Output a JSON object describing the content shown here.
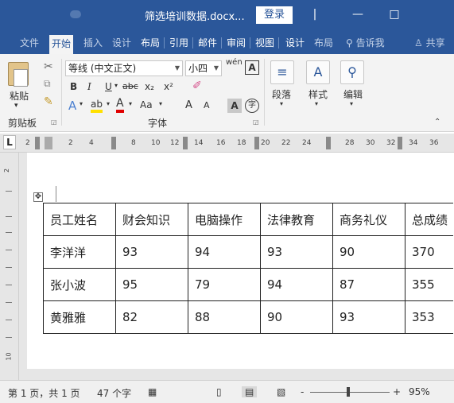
{
  "window": {
    "title": "筛选培训数据.docx...",
    "login_label": "登录",
    "controls": [
      "|",
      "—",
      "□"
    ]
  },
  "ribbon_tabs": [
    {
      "label": "文件",
      "style": "dim"
    },
    {
      "label": "开始",
      "style": "active"
    },
    {
      "label": "插入",
      "style": "dim"
    },
    {
      "label": "设计",
      "style": "dim"
    },
    {
      "label": "布局",
      "style": "normal"
    },
    {
      "label": "引用",
      "style": "normal"
    },
    {
      "label": "邮件",
      "style": "normal"
    },
    {
      "label": "审阅",
      "style": "normal"
    },
    {
      "label": "视图",
      "style": "normal"
    },
    {
      "label": "设计",
      "style": "normal"
    },
    {
      "label": "布局",
      "style": "dim"
    },
    {
      "label": "告诉我",
      "style": "dim"
    },
    {
      "label": "共享",
      "style": "dim"
    }
  ],
  "ribbon": {
    "clipboard": {
      "paste_label": "粘贴",
      "group_label": "剪贴板"
    },
    "font": {
      "font_name": "等线 (中文正文)",
      "font_size": "小四",
      "wen_label": "wén",
      "bold": "B",
      "italic": "I",
      "underline": "U",
      "strike": "abc",
      "subscript": "x₂",
      "superscript": "x²",
      "text_effects": "A",
      "highlight": "ab",
      "font_color": "A",
      "change_case": "Aa",
      "grow": "A",
      "shrink": "A",
      "shading": "A",
      "enclose": "字",
      "char_border": "A",
      "group_label": "字体"
    },
    "paragraph": {
      "label": "段落"
    },
    "styles": {
      "label": "样式"
    },
    "editing": {
      "label": "编辑"
    }
  },
  "ruler": {
    "corner": "L",
    "ticks": [
      "2",
      "2",
      "4",
      "8",
      "10",
      "12",
      "14",
      "16",
      "18",
      "20",
      "22",
      "24",
      "28",
      "30",
      "32",
      "34",
      "36"
    ]
  },
  "vruler": {
    "labels": [
      "2",
      "10"
    ]
  },
  "table": {
    "headers": [
      "员工姓名",
      "财会知识",
      "电脑操作",
      "法律教育",
      "商务礼仪",
      "总成绩"
    ],
    "rows": [
      [
        "李洋洋",
        "93",
        "94",
        "93",
        "90",
        "370"
      ],
      [
        "张小波",
        "95",
        "79",
        "94",
        "87",
        "355"
      ],
      [
        "黄雅雅",
        "82",
        "88",
        "90",
        "93",
        "353"
      ]
    ]
  },
  "statusbar": {
    "page": "第 1 页，共 1 页",
    "words": "47 个字",
    "zoom_minus": "-",
    "zoom_plus": "+",
    "zoom": "95%"
  },
  "colors": {
    "titlebar": "#2b579a",
    "ribbon_bg": "#f3f3f3"
  }
}
